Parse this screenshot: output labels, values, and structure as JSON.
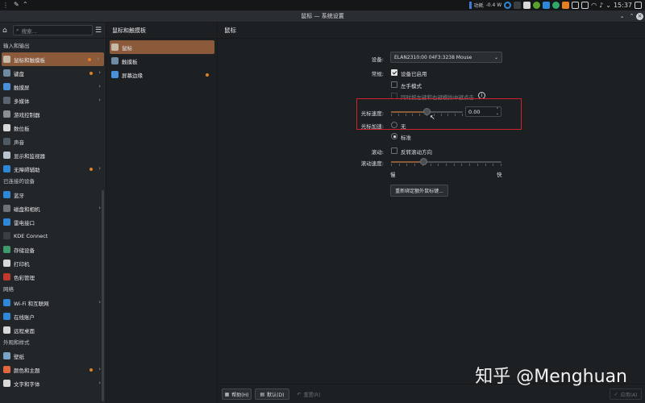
{
  "tray": {
    "net_label": "功耗",
    "net_value": "-0.4 W",
    "clock": "15:37"
  },
  "window": {
    "title": "鼠标 — 系统设置"
  },
  "sidebar": {
    "search_placeholder": "搜索...",
    "sections": [
      {
        "title": "输入和输出",
        "items": [
          {
            "label": "鼠标和触摸板",
            "selected": true,
            "dot": true,
            "chevron": true,
            "color": "#c7b9a8",
            "icon": "mouse-icon"
          },
          {
            "label": "键盘",
            "dot": true,
            "chevron": true,
            "color": "#6f8aa3",
            "icon": "keyboard-icon"
          },
          {
            "label": "触摸屏",
            "chevron": true,
            "color": "#4a90d9",
            "icon": "touchscreen-icon"
          },
          {
            "label": "多媒体",
            "chevron": true,
            "color": "#5a6470",
            "icon": "multimedia-icon"
          },
          {
            "label": "游戏控制器",
            "color": "#8a8f94",
            "icon": "gamepad-icon"
          },
          {
            "label": "数位板",
            "color": "#d8d8d8",
            "icon": "tablet-icon"
          },
          {
            "label": "声音",
            "color": "#4f5a63",
            "icon": "speaker-icon"
          },
          {
            "label": "显示和监视器",
            "color": "#b9c4ce",
            "icon": "monitor-icon"
          },
          {
            "label": "无障碍辅助",
            "dot": true,
            "chevron": true,
            "color": "#2f87d8",
            "icon": "accessibility-icon"
          }
        ]
      },
      {
        "title": "已连接的设备",
        "items": [
          {
            "label": "蓝牙",
            "color": "#2f87d8",
            "icon": "bluetooth-icon"
          },
          {
            "label": "磁盘和相机",
            "chevron": true,
            "color": "#6d7378",
            "icon": "disk-icon"
          },
          {
            "label": "雷电接口",
            "color": "#2f87d8",
            "icon": "thunderbolt-icon"
          },
          {
            "label": "KDE Connect",
            "color": "#3a3f44",
            "icon": "kde-connect-icon"
          },
          {
            "label": "存储设备",
            "color": "#3d9a6a",
            "icon": "storage-icon"
          },
          {
            "label": "打印机",
            "color": "#d8d8d8",
            "icon": "printer-icon"
          },
          {
            "label": "色彩管理",
            "color": "#c0392b",
            "icon": "color-icon"
          }
        ]
      },
      {
        "title": "网络",
        "items": [
          {
            "label": "Wi-Fi 和互联网",
            "chevron": true,
            "color": "#2f87d8",
            "icon": "wifi-icon"
          },
          {
            "label": "在线账户",
            "color": "#2f87d8",
            "icon": "accounts-icon"
          },
          {
            "label": "远程桌面",
            "color": "#d8d8d8",
            "icon": "remote-desktop-icon"
          }
        ]
      },
      {
        "title": "外观和样式",
        "items": [
          {
            "label": "壁纸",
            "color": "#7aa2c7",
            "icon": "wallpaper-icon"
          },
          {
            "label": "颜色和主题",
            "dot": true,
            "chevron": true,
            "color": "#e0683c",
            "icon": "theme-icon"
          },
          {
            "label": "文字和字体",
            "chevron": true,
            "color": "#d8d8d8",
            "icon": "fonts-icon"
          }
        ]
      }
    ]
  },
  "subpanel": {
    "title": "鼠标和触摸板",
    "items": [
      {
        "label": "鼠标",
        "selected": true,
        "color": "#c7b9a8",
        "icon": "mouse-icon"
      },
      {
        "label": "触摸板",
        "color": "#6f8aa3",
        "icon": "touchpad-icon"
      },
      {
        "label": "屏幕边缘",
        "dot": true,
        "color": "#4a90d9",
        "icon": "screen-edge-icon"
      }
    ]
  },
  "main": {
    "title": "鼠标",
    "device_label": "设备:",
    "device_value": "ELAN2310:00 04F3:3238 Mouse",
    "general_label": "常规:",
    "device_enabled": "设备已启用",
    "left_handed": "左手模式",
    "middle_click": "同时按左键和右键模拟中键点击",
    "speed_label": "光标速度:",
    "speed_value": "0.00",
    "speed_fraction": 0.5,
    "accel_label": "光标加速:",
    "accel_none": "无",
    "accel_standard": "标准",
    "scroll_label": "滚动:",
    "invert_scroll": "反转滚动方向",
    "scroll_speed_label": "滚动速度:",
    "scroll_slow": "慢",
    "scroll_fast": "快",
    "scroll_fraction": 0.3,
    "rebind_button": "重新绑定额外鼠标键..."
  },
  "bottom": {
    "help": "帮助(H)",
    "defaults": "默认(D)",
    "reset": "重置(R)",
    "apply": "应用(A)"
  },
  "watermark": "知乎 @Menghuan"
}
